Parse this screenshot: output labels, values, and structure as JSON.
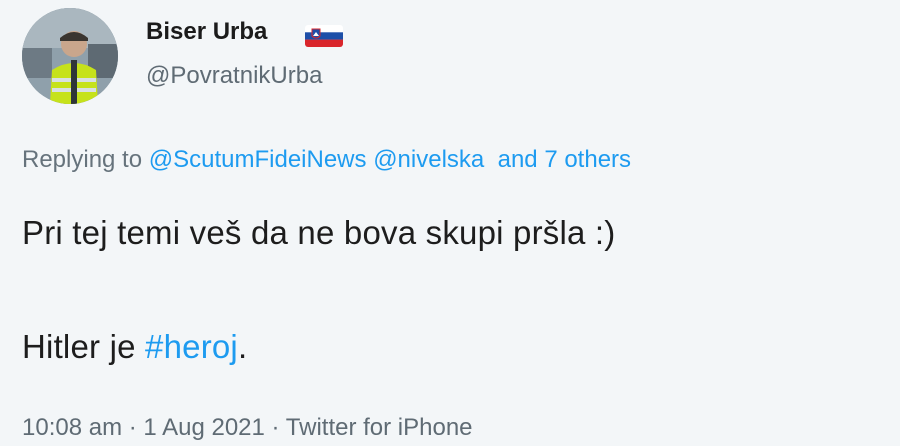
{
  "author": {
    "display_name": "Biser Urba",
    "handle": "@PovratnikUrba",
    "flag_icon": "slovenia-flag-icon"
  },
  "reply": {
    "prefix": "Replying to",
    "mentions": [
      "@ScutumFideiNews",
      "@nivelska"
    ],
    "others": "and 7 others"
  },
  "body": {
    "line1": "Pri tej temi veš da ne bova skupi pršla :)",
    "line2_prefix": "Hitler je ",
    "line2_hashtag": "#heroj",
    "line2_suffix": "."
  },
  "meta": {
    "time": "10:08 am",
    "separator": "·",
    "date": "1 Aug 2021",
    "source": "Twitter for iPhone"
  },
  "colors": {
    "background": "#f3f6f8",
    "link": "#1d9bf0",
    "secondary_text": "#5f6b74"
  }
}
